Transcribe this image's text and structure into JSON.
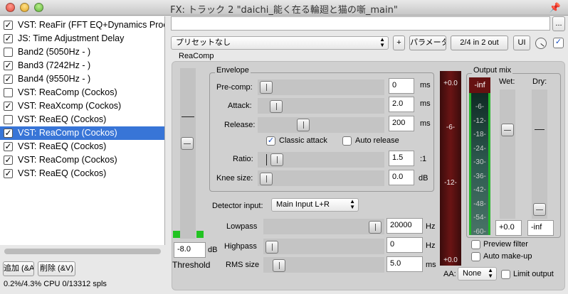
{
  "window": {
    "title": "FX: トラック 2 \"daichi_能く在る輪廻と猫の噺_main\""
  },
  "plugin_list": [
    {
      "label": "VST: ReaFir (FFT EQ+Dynamics Proc",
      "checked": true,
      "selected": false
    },
    {
      "label": "JS: Time Adjustment Delay",
      "checked": true,
      "selected": false
    },
    {
      "label": "Band2 (5050Hz - )",
      "checked": false,
      "selected": false
    },
    {
      "label": "Band3 (7242Hz - )",
      "checked": true,
      "selected": false
    },
    {
      "label": "Band4 (9550Hz - )",
      "checked": true,
      "selected": false
    },
    {
      "label": "VST: ReaComp (Cockos)",
      "checked": false,
      "selected": false
    },
    {
      "label": "VST: ReaXcomp (Cockos)",
      "checked": true,
      "selected": false
    },
    {
      "label": "VST: ReaEQ (Cockos)",
      "checked": false,
      "selected": false
    },
    {
      "label": "VST: ReaComp (Cockos)",
      "checked": true,
      "selected": true
    },
    {
      "label": "VST: ReaEQ (Cockos)",
      "checked": true,
      "selected": false
    },
    {
      "label": "VST: ReaComp (Cockos)",
      "checked": true,
      "selected": false
    },
    {
      "label": "VST: ReaEQ (Cockos)",
      "checked": true,
      "selected": false
    }
  ],
  "bottom": {
    "add_label": "追加 (&A)",
    "remove_label": "削除 (&V)",
    "status": "0.2%/4.3% CPU 0/13312 spls"
  },
  "top": {
    "more_label": "...",
    "preset_value": "プリセットなし",
    "plus_label": "+",
    "param_label": "パラメータ",
    "io_label": "2/4 in 2 out",
    "ui_label": "UI"
  },
  "reacomp": {
    "title": "ReaComp",
    "envelope_title": "Envelope",
    "threshold_label": "Threshold",
    "threshold_value": "-8.0",
    "threshold_unit": "dB",
    "precomp": {
      "label": "Pre-comp:",
      "value": "0",
      "unit": "ms"
    },
    "attack": {
      "label": "Attack:",
      "value": "2.0",
      "unit": "ms"
    },
    "release": {
      "label": "Release:",
      "value": "200",
      "unit": "ms"
    },
    "classic_attack": {
      "label": "Classic attack",
      "checked": true
    },
    "auto_release": {
      "label": "Auto release",
      "checked": false
    },
    "ratio": {
      "label": "Ratio:",
      "value": "1.5",
      "unit": ":1"
    },
    "knee": {
      "label": "Knee size:",
      "value": "0.0",
      "unit": "dB"
    },
    "detector": {
      "label": "Detector input:",
      "value": "Main Input L+R"
    },
    "lowpass": {
      "label": "Lowpass",
      "value": "20000",
      "unit": "Hz"
    },
    "highpass": {
      "label": "Highpass",
      "value": "0",
      "unit": "Hz"
    },
    "rms": {
      "label": "RMS size",
      "value": "5.0",
      "unit": "ms"
    },
    "meter_scale": [
      "+0.0",
      "-6-",
      "-12-",
      "+0.0"
    ],
    "output_mix_title": "Output mix",
    "output_peak": "-inf",
    "output_scale": [
      "-6-",
      "-12-",
      "-18-",
      "-24-",
      "-30-",
      "-36-",
      "-42-",
      "-48-",
      "-54-",
      "-60-"
    ],
    "wet_label": "Wet:",
    "dry_label": "Dry:",
    "wet_value": "+0.0",
    "dry_value": "-inf",
    "preview_filter": {
      "label": "Preview filter",
      "checked": false
    },
    "auto_makeup": {
      "label": "Auto make-up",
      "checked": false
    },
    "aa": {
      "label": "AA:",
      "value": "None"
    },
    "limit_output": {
      "label": "Limit output",
      "checked": false
    }
  }
}
